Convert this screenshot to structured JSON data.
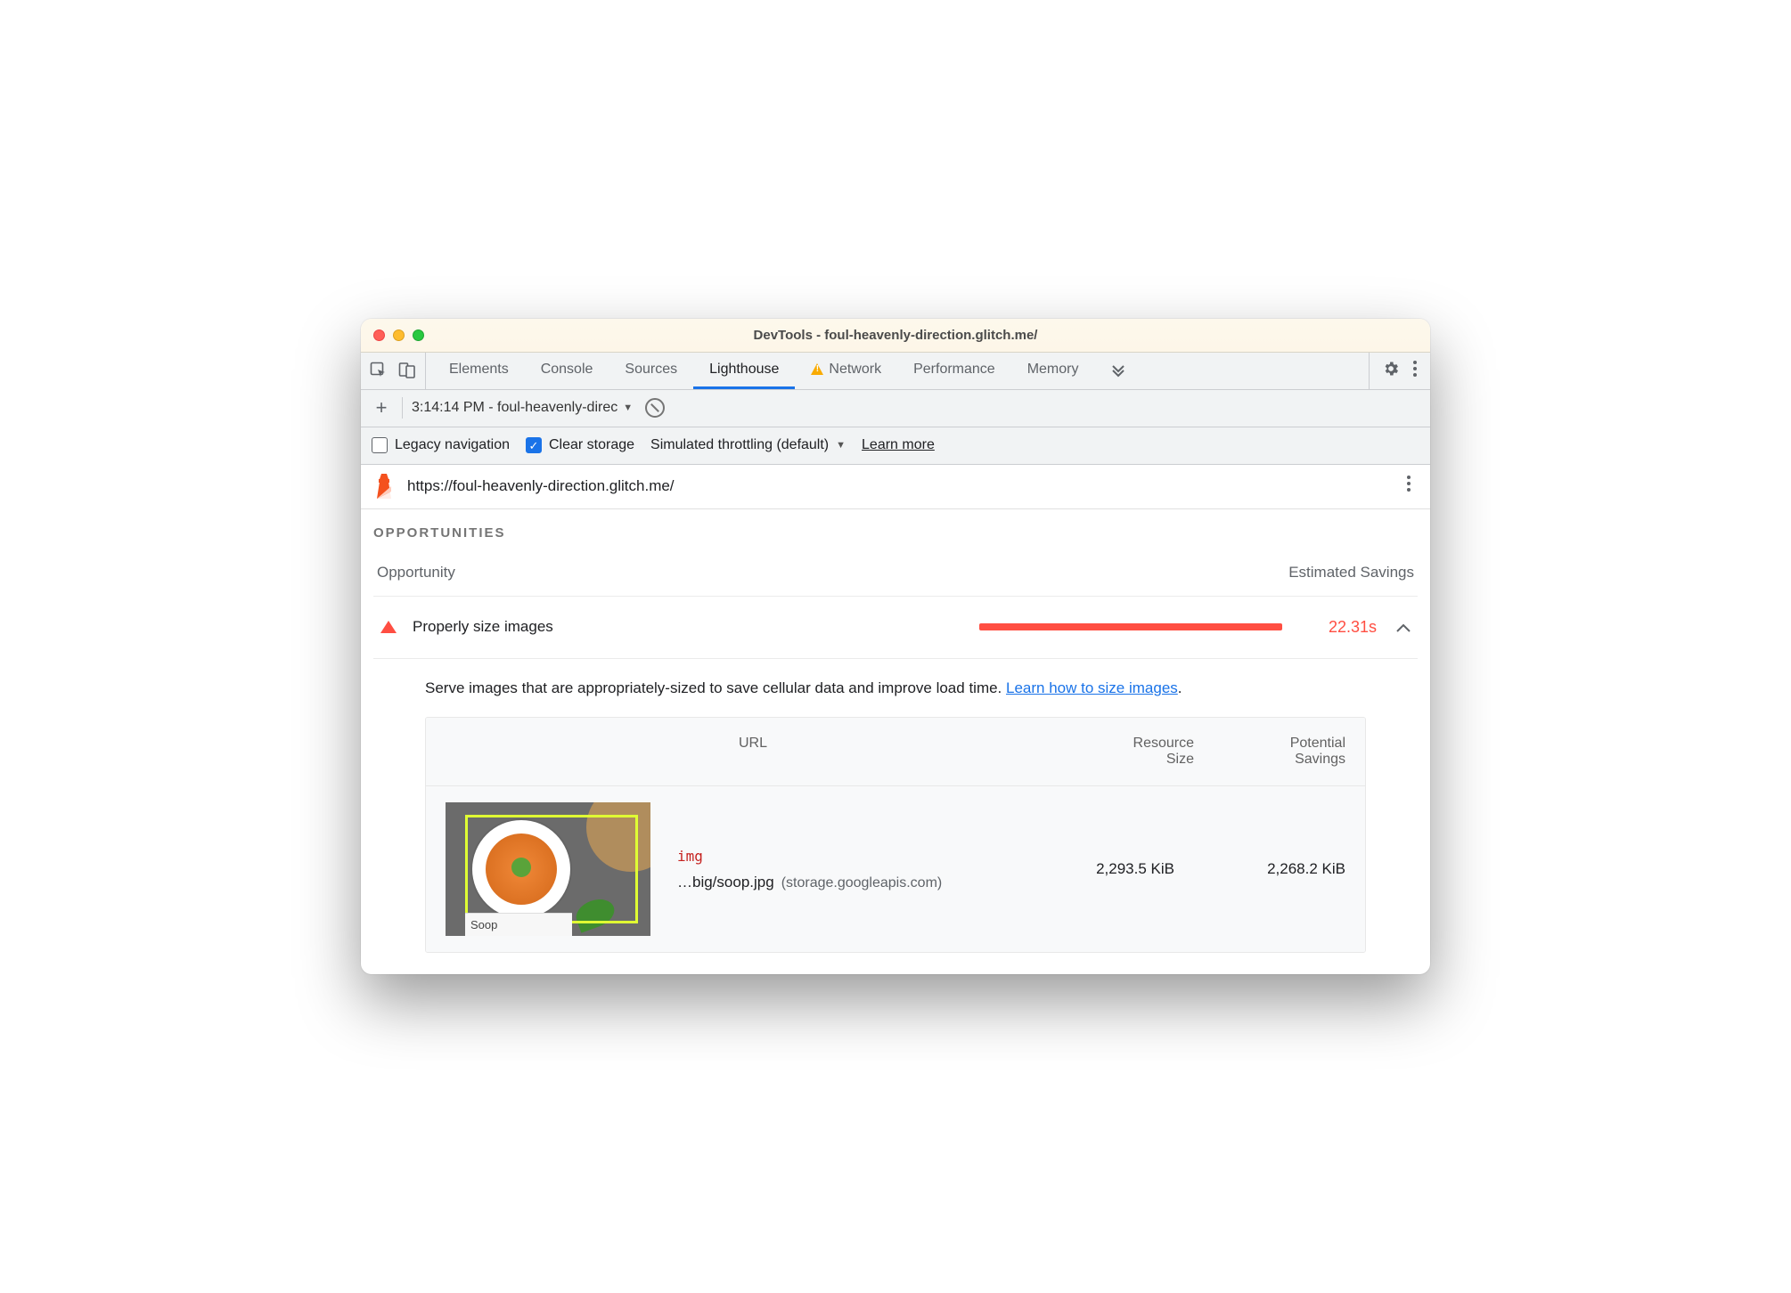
{
  "window": {
    "title": "DevTools - foul-heavenly-direction.glitch.me/"
  },
  "tabs": {
    "items": [
      "Elements",
      "Console",
      "Sources",
      "Lighthouse",
      "Network",
      "Performance",
      "Memory"
    ],
    "active": "Lighthouse",
    "warning_on": "Network"
  },
  "toolbar2": {
    "report_label": "3:14:14 PM - foul-heavenly-direc"
  },
  "toolbar3": {
    "legacy_label": "Legacy navigation",
    "clear_label": "Clear storage",
    "throttle_label": "Simulated throttling (default)",
    "learn_more": "Learn more"
  },
  "urlbar": {
    "url": "https://foul-heavenly-direction.glitch.me/"
  },
  "opportunities": {
    "heading": "OPPORTUNITIES",
    "col_opportunity": "Opportunity",
    "col_savings": "Estimated Savings",
    "item": {
      "title": "Properly size images",
      "savings": "22.31s",
      "desc_pre": "Serve images that are appropriately-sized to save cellular data and improve load time. ",
      "desc_link": "Learn how to size images",
      "desc_post": "."
    },
    "table": {
      "h_url": "URL",
      "h_size_l1": "Resource",
      "h_size_l2": "Size",
      "h_pot_l1": "Potential",
      "h_pot_l2": "Savings",
      "row": {
        "tag": "img",
        "path": "…big/soop.jpg",
        "host": "(storage.googleapis.com)",
        "thumb_label": "Soop",
        "size": "2,293.5 KiB",
        "potential": "2,268.2 KiB"
      }
    }
  }
}
